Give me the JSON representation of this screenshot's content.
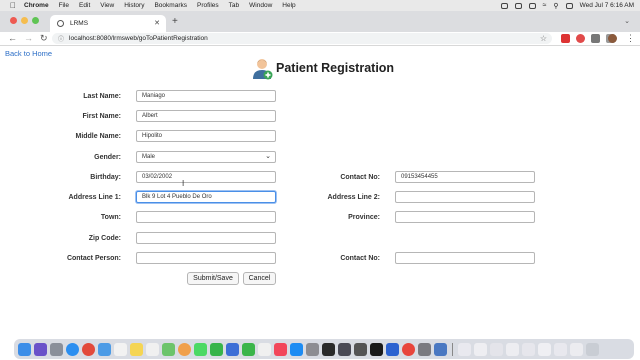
{
  "menubar": {
    "items": [
      "Chrome",
      "File",
      "Edit",
      "View",
      "History",
      "Bookmarks",
      "Profiles",
      "Tab",
      "Window",
      "Help"
    ],
    "clock": "Wed Jul 7  6:16 AM"
  },
  "browser": {
    "tab_title": "LRMS",
    "url": "localhost:8080/lrmsweb/goToPatientRegistration"
  },
  "page": {
    "back_link": "Back to Home",
    "title": "Patient Registration",
    "labels": {
      "last_name": "Last Name:",
      "first_name": "First Name:",
      "middle_name": "Middle Name:",
      "gender": "Gender:",
      "birthday": "Birthday:",
      "address1": "Address Line 1:",
      "town": "Town:",
      "zip": "Zip Code:",
      "contact_person": "Contact Person:",
      "contact_no": "Contact No:",
      "address2": "Address Line 2:",
      "province": "Province:",
      "contact_no_2": "Contact No:"
    },
    "values": {
      "last_name": "Maniago",
      "first_name": "Albert",
      "middle_name": "Hipolito",
      "gender": "Male",
      "birthday": "03/02/2002",
      "address1": "Blk 9 Lot 4 Pueblo De Oro",
      "town": "",
      "zip": "",
      "contact_person": "",
      "contact_no": "09153454455",
      "address2": "",
      "province": "",
      "contact_no_2": ""
    },
    "buttons": {
      "submit": "Submit/Save",
      "cancel": "Cancel"
    }
  },
  "colors": {
    "link": "#2d6fc7",
    "focus_border": "#4a8fe7"
  }
}
